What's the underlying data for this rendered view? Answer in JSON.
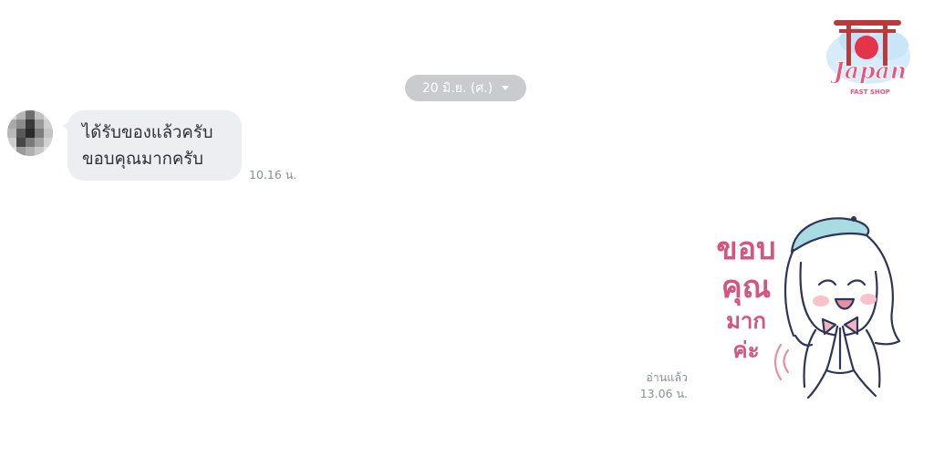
{
  "chat": {
    "date_separator": "20 มิ.ย. (ศ.)",
    "incoming": {
      "line1": "ได้รับของแล้วครับ",
      "line2": "ขอบคุณมากครับ",
      "time": "10.16 น."
    },
    "outgoing": {
      "sticker": {
        "line1": "ขอบ",
        "line2": "คุณ",
        "line3": "มาก",
        "line4": "ค่ะ"
      },
      "read_label": "อ่านแล้ว",
      "time": "13.06 น."
    }
  },
  "watermark": {
    "brand": "Japan",
    "tagline": "FAST SHOP"
  },
  "colors": {
    "bubble_incoming": "#eceef1",
    "date_pill": "#c9cccf",
    "sticker_text": "#d3567f",
    "meta_text": "#8a8f96"
  }
}
